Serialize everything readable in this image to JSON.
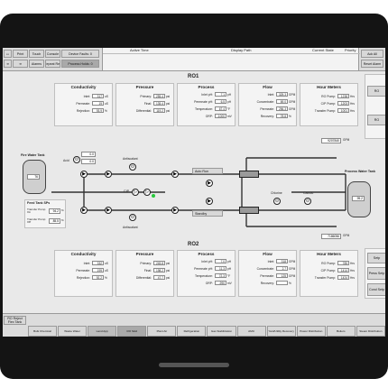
{
  "top_bar": {
    "buttons": [
      "Print",
      "Touch",
      "Console",
      "Alarms"
    ],
    "device_faults": "Device Faults: 0",
    "repeat_reg": "Repeat Reg",
    "process_holds": "Process Holds: 0",
    "columns": [
      "Active Time",
      "Display Path",
      "Current State",
      "Priority"
    ],
    "ack_all": "Ack All",
    "reset_alarm": "Reset Alarm"
  },
  "ro1": {
    "title": "RO1",
    "conductivity": {
      "title": "Conductivity",
      "rows": [
        {
          "label": "Inlet:",
          "value": "317",
          "unit": "uS"
        },
        {
          "label": "Permeate:",
          "value": "19",
          "unit": "uS"
        },
        {
          "label": "Rejection:",
          "value": "93.9",
          "unit": "%"
        }
      ]
    },
    "pressure": {
      "title": "Pressure",
      "rows": [
        {
          "label": "Primary:",
          "value": "255.4",
          "unit": "psi"
        },
        {
          "label": "Final:",
          "value": "135.4",
          "unit": "psi"
        },
        {
          "label": "Differential:",
          "value": "119.2",
          "unit": "psi"
        }
      ]
    },
    "process": {
      "title": "Process",
      "rows": [
        {
          "label": "Inlet pH:",
          "value": "7.1",
          "unit": "pH"
        },
        {
          "label": "Permeate pH:",
          "value": "6.5",
          "unit": "pH"
        },
        {
          "label": "Temperature:",
          "value": "67.4",
          "unit": "°F"
        },
        {
          "label": "ORP:",
          "value": "-1000",
          "unit": "mV"
        }
      ]
    },
    "flow": {
      "title": "Flow",
      "rows": [
        {
          "label": "Inlet:",
          "value": "325.3",
          "unit": "GPM"
        },
        {
          "label": "Concentrate:",
          "value": "69.0",
          "unit": "GPM"
        },
        {
          "label": "Permeate:",
          "value": "256.3",
          "unit": "GPM"
        },
        {
          "label": "Recovery:",
          "value": "78.8",
          "unit": "%"
        }
      ]
    },
    "hour_meters": {
      "title": "Hour Meters",
      "rows": [
        {
          "label": "RO Pump:",
          "value": "1238",
          "unit": "Hrs"
        },
        {
          "label": "CIP Pump:",
          "value": "1203",
          "unit": "Hrs"
        },
        {
          "label": "Transfer Pump:",
          "value": "1001",
          "unit": "Hrs"
        }
      ]
    }
  },
  "ro2": {
    "title": "RO2",
    "conductivity": {
      "title": "Conductivity",
      "rows": [
        {
          "label": "Inlet:",
          "value": "332",
          "unit": "uS"
        },
        {
          "label": "Permeate:",
          "value": "199",
          "unit": "uS"
        },
        {
          "label": "Rejection:",
          "value": "92.2",
          "unit": "%"
        }
      ]
    },
    "pressure": {
      "title": "Pressure",
      "rows": [
        {
          "label": "Primary:",
          "value": "245.8",
          "unit": "psi"
        },
        {
          "label": "Final:",
          "value": "198.2",
          "unit": "psi"
        },
        {
          "label": "Differential:",
          "value": "47.7",
          "unit": "psi"
        }
      ]
    },
    "process": {
      "title": "Process",
      "rows": [
        {
          "label": "Inlet pH:",
          "value": "7.0",
          "unit": "pH"
        },
        {
          "label": "Permeate pH:",
          "value": "11.3",
          "unit": "pH"
        },
        {
          "label": "Temperature:",
          "value": "72.3",
          "unit": "°F"
        },
        {
          "label": "ORP:",
          "value": "-990",
          "unit": "mV"
        }
      ]
    },
    "flow": {
      "title": "Flow",
      "rows": [
        {
          "label": "Inlet:",
          "value": "318",
          "unit": "GPM"
        },
        {
          "label": "Concentrate:",
          "value": "2.7",
          "unit": "GPM"
        },
        {
          "label": "Permeate:",
          "value": "125",
          "unit": "GPM"
        },
        {
          "label": "Recovery:",
          "value": "",
          "unit": "%"
        }
      ]
    },
    "hour_meters": {
      "title": "Hour Meters",
      "rows": [
        {
          "label": "RO Pump:",
          "value": "785",
          "unit": "Hrs"
        },
        {
          "label": "CIP Pump:",
          "value": "1414",
          "unit": "Hrs"
        },
        {
          "label": "Transfer Pump:",
          "value": "1424",
          "unit": "Hrs"
        }
      ]
    }
  },
  "process_diagram": {
    "fire_water_tank": "Fire Water Tank",
    "fire_tank_value": "76",
    "acid_label": "Acid",
    "acid_value_1": "0.0",
    "acid_value_2": "0.0",
    "antiscalant_top": "Antiscalant",
    "antiscalant_bottom": "Antiscalant",
    "cip_label": "CIP",
    "auto_run": "Auto Run",
    "standby": "Standby",
    "chlorine": "Chlorine",
    "caustic": "Caustic",
    "process_water_tank": "Process Water Tank",
    "process_tank_value": "99.2",
    "top_total": "9207840",
    "top_total_unit": "GPM",
    "bottom_total": "7186056",
    "bottom_total_unit": "GPM",
    "feed_tank_sps": "Feed Tank SPs",
    "transfer_on_label": "Transfer Pump On",
    "transfer_on_value": "94.2",
    "transfer_off_label": "Transfer Pump Off",
    "transfer_off_value": "85.5",
    "pct": "%"
  },
  "right_side": {
    "top_labels": [
      "RO",
      "RO"
    ],
    "bottom_buttons": [
      "Setp",
      "Press Setp",
      "Cond Setp"
    ]
  },
  "nav": {
    "ro_reject": "RO Reject Flex Tank",
    "tabs": [
      "Bulk Chemical",
      "Waste Water",
      "Land App",
      "RO Skid",
      "Plant Air",
      "Refrigeration",
      "Gas Stabilization",
      "AMU",
      "Yard/Utility Recovery",
      "Power Distribution",
      "Boilers",
      "Steam Distribution"
    ],
    "active_tab": "RO Skid"
  }
}
